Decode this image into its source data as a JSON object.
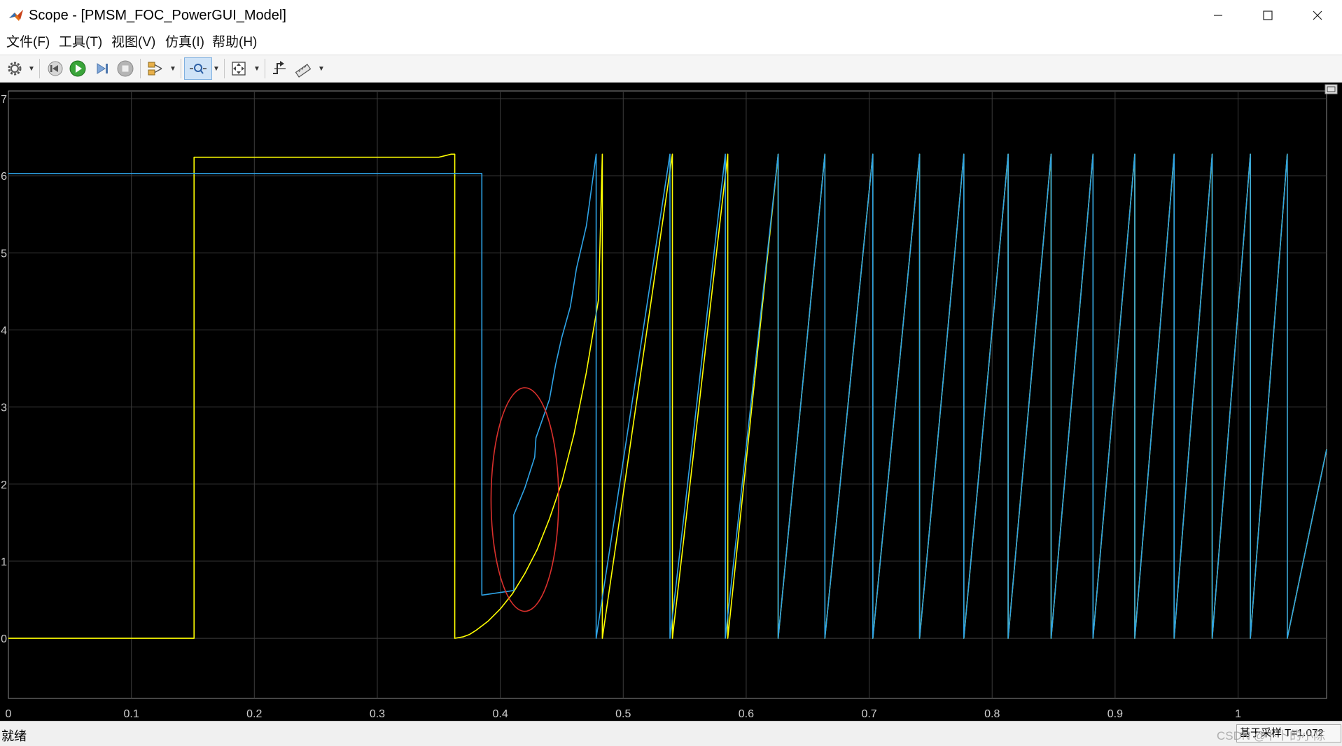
{
  "window": {
    "title": "Scope - [PMSM_FOC_PowerGUI_Model]",
    "controls": {
      "minimize": "—",
      "maximize": "☐",
      "close": "✕"
    }
  },
  "menu": [
    "文件(F)",
    "工具(T)",
    "视图(V)",
    "仿真(I)",
    "帮助(H)"
  ],
  "toolbar": {
    "buttons": [
      {
        "name": "gear-icon",
        "dropdown": true
      },
      {
        "name": "step-back-icon"
      },
      {
        "name": "run-icon"
      },
      {
        "name": "step-forward-icon"
      },
      {
        "name": "stop-icon"
      },
      {
        "name": "highlight-signal-icon",
        "dropdown": true
      },
      {
        "name": "zoom-icon",
        "dropdown": true,
        "active": true
      },
      {
        "name": "autoscale-icon",
        "dropdown": true
      },
      {
        "name": "trigger-icon"
      },
      {
        "name": "cursor-measure-icon",
        "dropdown": true
      }
    ]
  },
  "chart_data": {
    "type": "line",
    "background": "#000000",
    "grid": true,
    "xlim": [
      0,
      1.072
    ],
    "ylim": [
      -0.78,
      7.1
    ],
    "x_ticks": [
      "0",
      "0.1",
      "0.2",
      "0.3",
      "0.4",
      "0.5",
      "0.6",
      "0.7",
      "0.8",
      "0.9",
      "1"
    ],
    "y_ticks": [
      "0",
      "1",
      "2",
      "3",
      "4",
      "5",
      "6",
      "7"
    ],
    "series": [
      {
        "color": "#ffff00",
        "points": [
          [
            0,
            0
          ],
          [
            0.151,
            0
          ],
          [
            0.151,
            6.24
          ],
          [
            0.35,
            6.24
          ],
          [
            0.36,
            6.28
          ],
          [
            0.363,
            6.28
          ],
          [
            0.363,
            0
          ],
          [
            0.37,
            0.02
          ],
          [
            0.375,
            0.05
          ],
          [
            0.38,
            0.1
          ],
          [
            0.39,
            0.22
          ],
          [
            0.4,
            0.38
          ],
          [
            0.41,
            0.58
          ],
          [
            0.42,
            0.84
          ],
          [
            0.43,
            1.15
          ],
          [
            0.44,
            1.55
          ],
          [
            0.45,
            2.02
          ],
          [
            0.46,
            2.65
          ],
          [
            0.47,
            3.45
          ],
          [
            0.48,
            4.4
          ],
          [
            0.483,
            6.28
          ],
          [
            0.483,
            0
          ],
          [
            0.54,
            6.28
          ],
          [
            0.54,
            0
          ],
          [
            0.585,
            6.28
          ],
          [
            0.585,
            0
          ],
          [
            0.626,
            6.28
          ],
          [
            0.626,
            0
          ],
          [
            0.664,
            6.28
          ],
          [
            0.664,
            0
          ],
          [
            0.703,
            6.28
          ],
          [
            0.703,
            0
          ],
          [
            0.741,
            6.28
          ],
          [
            0.741,
            0
          ],
          [
            0.777,
            6.28
          ],
          [
            0.777,
            0
          ],
          [
            0.813,
            6.28
          ],
          [
            0.813,
            0
          ],
          [
            0.848,
            6.28
          ],
          [
            0.848,
            0
          ],
          [
            0.882,
            6.28
          ],
          [
            0.882,
            0
          ],
          [
            0.916,
            6.28
          ],
          [
            0.916,
            0
          ],
          [
            0.948,
            6.28
          ],
          [
            0.948,
            0
          ],
          [
            0.979,
            6.28
          ],
          [
            0.979,
            0
          ],
          [
            1.01,
            6.28
          ],
          [
            1.01,
            0
          ],
          [
            1.04,
            6.28
          ],
          [
            1.04,
            0
          ],
          [
            1.072,
            2.45
          ]
        ]
      },
      {
        "color": "#2ea3e6",
        "points": [
          [
            0,
            6.03
          ],
          [
            0.385,
            6.03
          ],
          [
            0.385,
            0.56
          ],
          [
            0.411,
            0.62
          ],
          [
            0.411,
            1.6
          ],
          [
            0.42,
            1.95
          ],
          [
            0.428,
            2.35
          ],
          [
            0.429,
            2.6
          ],
          [
            0.44,
            3.1
          ],
          [
            0.445,
            3.55
          ],
          [
            0.45,
            3.9
          ],
          [
            0.457,
            4.3
          ],
          [
            0.462,
            4.8
          ],
          [
            0.47,
            5.35
          ],
          [
            0.478,
            6.28
          ],
          [
            0.478,
            0
          ],
          [
            0.538,
            6.28
          ],
          [
            0.538,
            0
          ],
          [
            0.583,
            6.28
          ],
          [
            0.583,
            0
          ],
          [
            0.626,
            6.28
          ],
          [
            0.626,
            0
          ],
          [
            0.664,
            6.28
          ],
          [
            0.664,
            0
          ],
          [
            0.703,
            6.28
          ],
          [
            0.703,
            0
          ],
          [
            0.741,
            6.28
          ],
          [
            0.741,
            0
          ],
          [
            0.777,
            6.28
          ],
          [
            0.777,
            0
          ],
          [
            0.813,
            6.28
          ],
          [
            0.813,
            0
          ],
          [
            0.848,
            6.28
          ],
          [
            0.848,
            0
          ],
          [
            0.882,
            6.28
          ],
          [
            0.882,
            0
          ],
          [
            0.916,
            6.28
          ],
          [
            0.916,
            0
          ],
          [
            0.948,
            6.28
          ],
          [
            0.948,
            0
          ],
          [
            0.979,
            6.28
          ],
          [
            0.979,
            0
          ],
          [
            1.01,
            6.28
          ],
          [
            1.01,
            0
          ],
          [
            1.04,
            6.28
          ],
          [
            1.04,
            0
          ],
          [
            1.072,
            2.45
          ]
        ]
      }
    ],
    "annotation": {
      "shape": "ellipse",
      "color": "#d9302c",
      "center": [
        0.42,
        1.8
      ],
      "rx": 0.0275,
      "ry": 1.45
    }
  },
  "status": {
    "left": "就绪",
    "right": "基于采样  T=1.072",
    "watermark": "CSDN @卜卜的小陈"
  }
}
